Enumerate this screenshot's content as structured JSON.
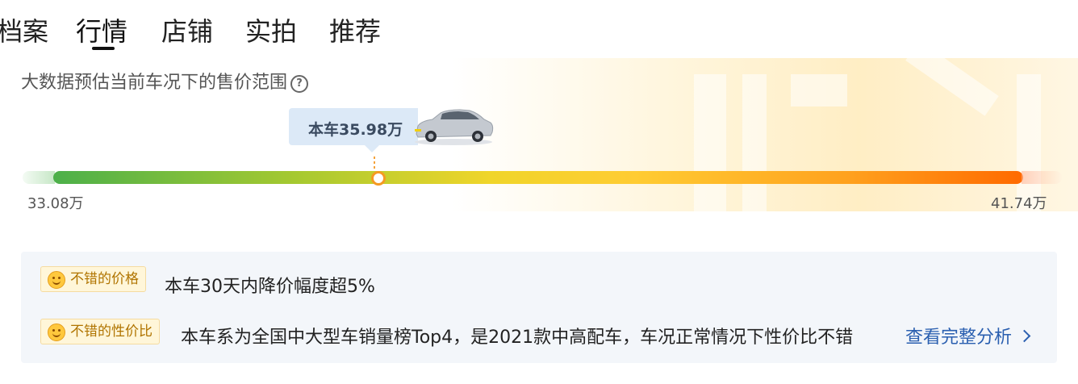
{
  "tabs": [
    {
      "label": "档案",
      "active": false
    },
    {
      "label": "行情",
      "active": true
    },
    {
      "label": "店铺",
      "active": false
    },
    {
      "label": "实拍",
      "active": false
    },
    {
      "label": "推荐",
      "active": false
    }
  ],
  "price": {
    "subtitle": "大数据预估当前车况下的售价范围",
    "current_label": "本车35.98万",
    "min_label": "33.08万",
    "max_label": "41.74万",
    "marker_fraction": 0.335
  },
  "analysis": {
    "items": [
      {
        "tag": "不错的价格",
        "text": "本车30天内降价幅度超5%"
      },
      {
        "tag": "不错的性价比",
        "text": "本车系为全国中大型车销量榜Top4，是2021款中高配车，车况正常情况下性价比不错"
      }
    ],
    "more_link": "查看完整分析"
  },
  "colors": {
    "bar_start": "#4cb04a",
    "bar_end": "#ff6a00",
    "marker": "#f59a23",
    "link": "#2a5fb0",
    "tag_text": "#b07400"
  },
  "icons": {
    "help": "question-circle-icon",
    "tag": "smile-face-icon",
    "more": "chevron-right-icon"
  }
}
